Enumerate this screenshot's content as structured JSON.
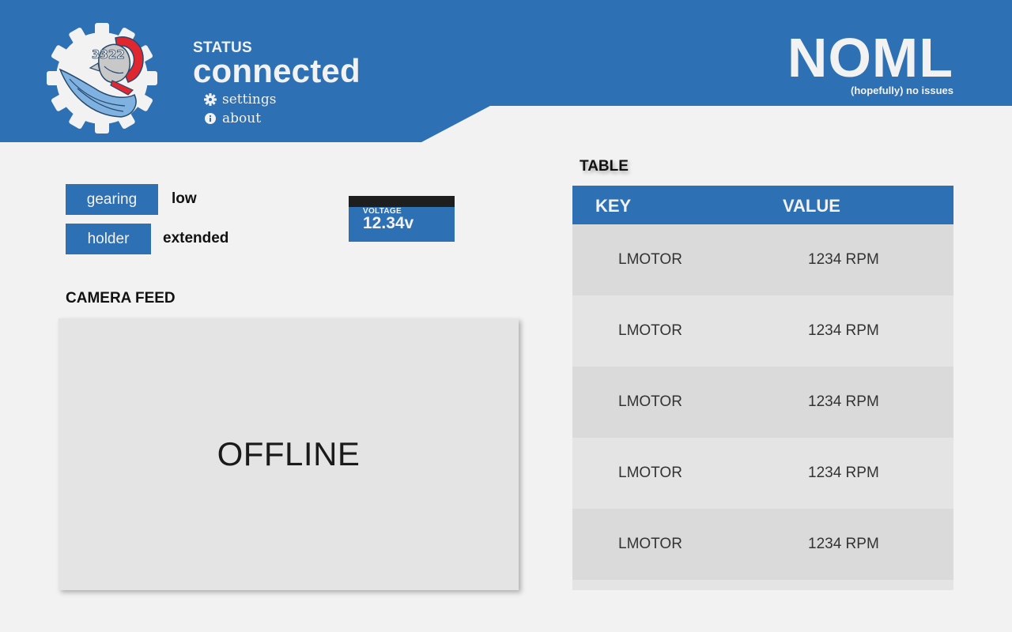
{
  "header": {
    "status_label": "STATUS",
    "status_value": "connected",
    "nav": [
      {
        "label": "settings",
        "icon": "gear-icon"
      },
      {
        "label": "about",
        "icon": "info-icon"
      }
    ],
    "brand_title": "NOML",
    "brand_subtitle": "(hopefully) no issues",
    "logo_text": "3322",
    "accent_color": "#2e70b4"
  },
  "controls": {
    "gearing": {
      "label": "gearing",
      "value": "low"
    },
    "holder": {
      "label": "holder",
      "value": "extended"
    }
  },
  "voltage": {
    "label": "VOLTAGE",
    "value": "12.34v"
  },
  "camera": {
    "title": "CAMERA FEED",
    "status": "OFFLINE"
  },
  "table": {
    "title": "TABLE",
    "headers": [
      "KEY",
      "VALUE"
    ],
    "rows": [
      {
        "key": "LMOTOR",
        "value": "1234 RPM"
      },
      {
        "key": "LMOTOR",
        "value": "1234 RPM"
      },
      {
        "key": "LMOTOR",
        "value": "1234 RPM"
      },
      {
        "key": "LMOTOR",
        "value": "1234 RPM"
      },
      {
        "key": "LMOTOR",
        "value": "1234 RPM"
      }
    ]
  }
}
